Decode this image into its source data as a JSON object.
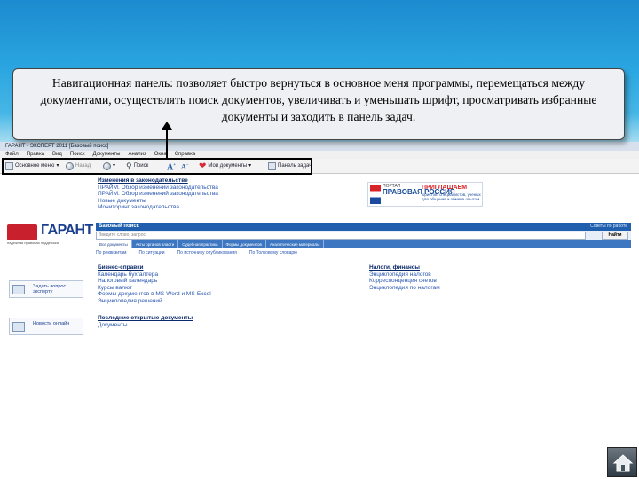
{
  "callout": {
    "text": "Навигационная панель: позволяет быстро вернуться в основное меня программы, перемещаться между документами, осуществлять поиск документов, увеличивать и уменьшать шрифт, просматривать избранные документы и заходить в панель задач."
  },
  "app": {
    "title": "ГАРАНТ - ЭКСПЕРТ 2011 [Базовый поиск]",
    "menu": [
      "Файл",
      "Правка",
      "Вид",
      "Поиск",
      "Документы",
      "Анализ",
      "Окна",
      "Справка"
    ],
    "toolbar": {
      "main_menu": "Основное меню",
      "back": "Назад",
      "search": "Поиск",
      "my_docs": "Мои документы",
      "task_panel": "Панель задач"
    }
  },
  "legislation": {
    "heading": "Изменения в законодательстве",
    "links": [
      "ПРАЙМ. Обзор изменений законодательства",
      "ПРАЙМ. Обзор изменений законодательства",
      "Новые документы",
      "Мониторинг законодательства"
    ]
  },
  "banner": {
    "small": "ПОРТАЛ",
    "brand": "ПРАВОВАЯ РОССИЯ",
    "invite": "ПРИГЛАШАЕМ",
    "invite_text": "юристов, специалистов, ученых для общения и обмена опытом"
  },
  "garant": {
    "name": "ГАРАНТ",
    "tagline": "надежная правовая поддержка"
  },
  "search": {
    "title": "Базовый поиск",
    "right_link": "Советы по работе",
    "placeholder": "Введите слово, запрос",
    "button": "Найти",
    "tabs": [
      "Все документы",
      "Акты органов власти",
      "Судебная практика",
      "Формы документов",
      "Аналитические материалы"
    ],
    "links": [
      "По реквизитам",
      "По ситуации",
      "По источнику опубликования",
      "По Толковому словарю"
    ]
  },
  "business": {
    "heading": "Бизнес-справки",
    "links": [
      "Календарь бухгалтера",
      "Налоговый календарь",
      "Курсы валют",
      "Формы документов в MS-Word и MS-Excel",
      "Энциклопедия решений"
    ]
  },
  "taxes": {
    "heading": "Налоги, финансы",
    "links": [
      "Энциклопедия налогов",
      "Корреспонденция счетов",
      "Энциклопедия по налогам"
    ]
  },
  "recent": {
    "heading": "Последние открытые документы",
    "links": [
      "Документы"
    ]
  },
  "side_buttons": [
    {
      "label": "Задать вопрос эксперту"
    },
    {
      "label": "Новости онлайн"
    }
  ],
  "colors": {
    "slide_blue": "#2aa5e0",
    "garant_red": "#c8202d",
    "garant_blue": "#1b3f8f",
    "search_blue": "#1f5fae"
  },
  "icons": {
    "home": "home-icon",
    "font_increase": "font-increase-icon",
    "font_decrease": "font-decrease-icon",
    "favorites": "heart-icon"
  }
}
